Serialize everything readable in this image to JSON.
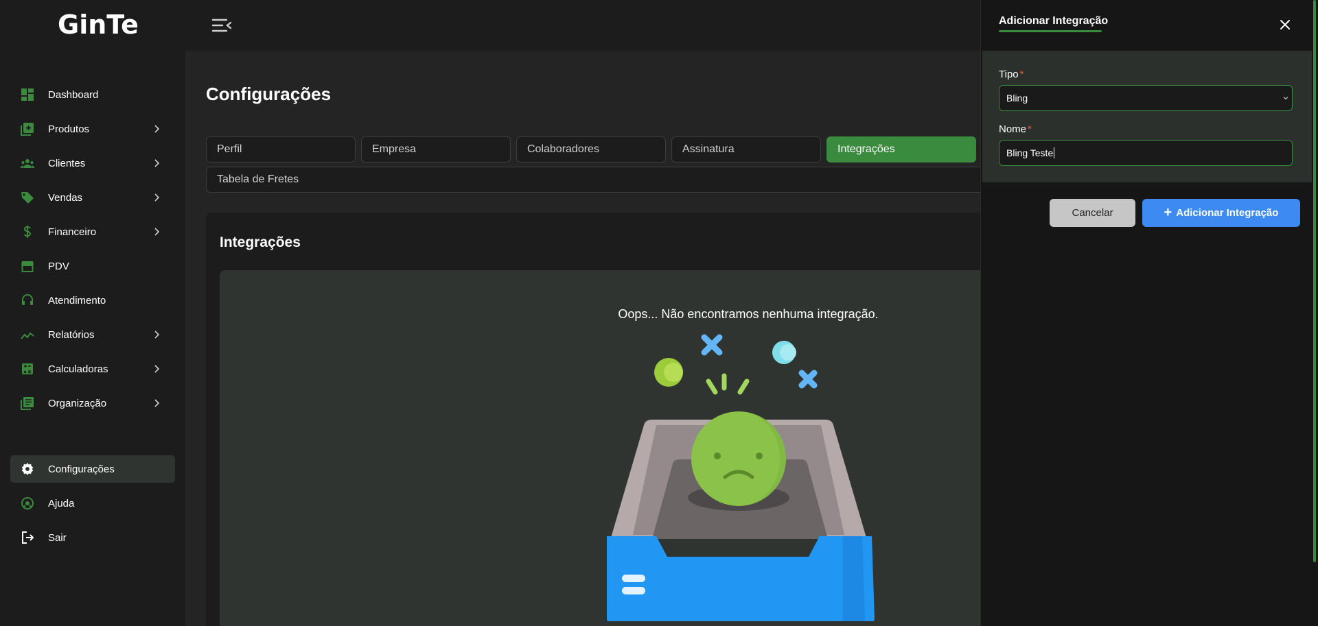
{
  "app": {
    "logo_text": "GinTe"
  },
  "sidebar": {
    "items": [
      {
        "label": "Dashboard",
        "icon": "dashboard-icon",
        "has_submenu": false
      },
      {
        "label": "Produtos",
        "icon": "add-box-icon",
        "has_submenu": true
      },
      {
        "label": "Clientes",
        "icon": "people-icon",
        "has_submenu": true
      },
      {
        "label": "Vendas",
        "icon": "tag-icon",
        "has_submenu": true
      },
      {
        "label": "Financeiro",
        "icon": "dollar-icon",
        "has_submenu": true
      },
      {
        "label": "PDV",
        "icon": "store-icon",
        "has_submenu": false
      },
      {
        "label": "Atendimento",
        "icon": "headset-icon",
        "has_submenu": false
      },
      {
        "label": "Relatórios",
        "icon": "trend-icon",
        "has_submenu": true
      },
      {
        "label": "Calculadoras",
        "icon": "calculator-icon",
        "has_submenu": true
      },
      {
        "label": "Organização",
        "icon": "list-icon",
        "has_submenu": true
      }
    ],
    "bottom_items": [
      {
        "label": "Configurações",
        "icon": "gear-icon",
        "active": true
      },
      {
        "label": "Ajuda",
        "icon": "help-icon",
        "active": false
      },
      {
        "label": "Sair",
        "icon": "logout-icon",
        "active": false
      }
    ]
  },
  "main": {
    "title": "Configurações",
    "tabs": [
      {
        "label": "Perfil",
        "active": false
      },
      {
        "label": "Empresa",
        "active": false
      },
      {
        "label": "Colaboradores",
        "active": false
      },
      {
        "label": "Assinatura",
        "active": false
      },
      {
        "label": "Integrações",
        "active": true
      },
      {
        "label": "Tabela de Fretes",
        "active": false
      }
    ],
    "card": {
      "title": "Integrações",
      "empty_message": "Oops... Não encontramos nenhuma integração."
    }
  },
  "panel": {
    "title": "Adicionar Integração",
    "fields": {
      "tipo": {
        "label": "Tipo",
        "required_mark": "*",
        "value": "Bling"
      },
      "nome": {
        "label": "Nome",
        "required_mark": "*",
        "value": "Bling Teste"
      }
    },
    "cancel_label": "Cancelar",
    "add_label": "Adicionar Integração"
  },
  "colors": {
    "accent_green": "#3a8b3e",
    "primary_blue": "#3d8bf2",
    "required_red": "#e05a3a"
  }
}
